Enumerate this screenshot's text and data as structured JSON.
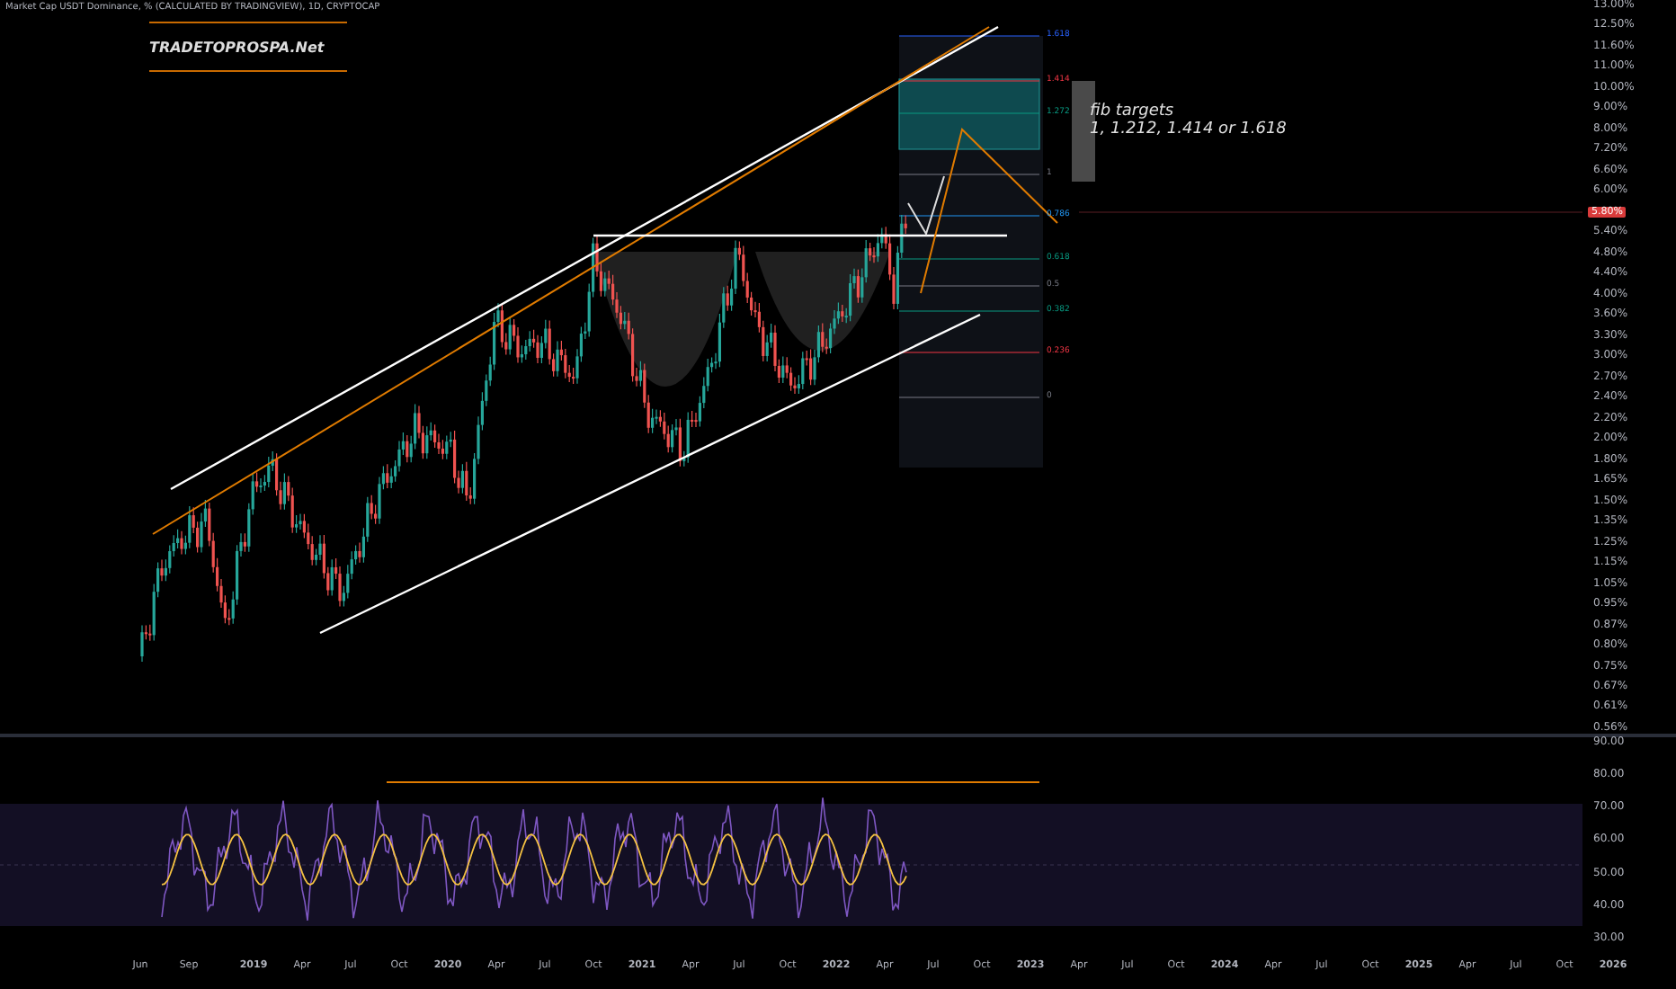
{
  "header": {
    "symbol": "Market Cap USDT Dominance, % (CALCULATED BY TRADINGVIEW), 1D, CRYPTOCAP"
  },
  "brand": {
    "label": "TRADETOPROSPA.Net"
  },
  "annotation": {
    "title": "fib targets",
    "text": "1, 1.212, 1.414 or 1.618"
  },
  "fib_levels": [
    "1.618",
    "1.414",
    "1.272",
    "1",
    "0.786",
    "0.618",
    "0.5",
    "0.382",
    "0.236",
    "0"
  ],
  "price_axis": {
    "labels": [
      "13.00%",
      "12.50%",
      "11.60%",
      "11.00%",
      "10.00%",
      "9.00%",
      "8.00%",
      "7.20%",
      "6.60%",
      "6.00%",
      "5.40%",
      "4.80%",
      "4.40%",
      "4.00%",
      "3.60%",
      "3.30%",
      "3.00%",
      "2.70%",
      "2.40%",
      "2.20%",
      "2.00%",
      "1.80%",
      "1.65%",
      "1.50%",
      "1.35%",
      "1.25%",
      "1.15%",
      "1.05%",
      "0.95%",
      "0.87%",
      "0.80%",
      "0.75%",
      "0.67%",
      "0.61%",
      "0.56%"
    ],
    "current_price": "5.80%"
  },
  "rsi_axis": {
    "labels": [
      "90.00",
      "80.00",
      "70.00",
      "60.00",
      "50.00",
      "40.00",
      "30.00"
    ]
  },
  "time_axis": {
    "labels": [
      "Jun",
      "Sep",
      "2019",
      "Apr",
      "Jul",
      "Oct",
      "2020",
      "Apr",
      "Jul",
      "Oct",
      "2021",
      "Apr",
      "Jul",
      "Oct",
      "2022",
      "Apr",
      "Jul",
      "Oct",
      "2023",
      "Apr",
      "Jul",
      "Oct",
      "2024",
      "Apr",
      "Jul",
      "Oct",
      "2025",
      "Apr",
      "Jul",
      "Oct",
      "2026"
    ]
  }
}
